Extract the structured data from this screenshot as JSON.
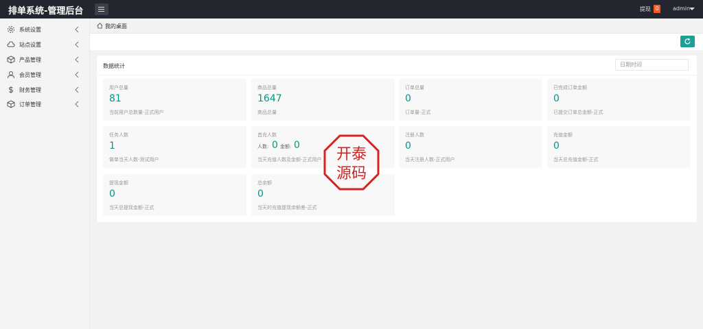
{
  "header": {
    "brand": "排单系统-管理后台",
    "withdraw_label": "提现",
    "withdraw_count": "0",
    "user": "admin"
  },
  "sidebar": {
    "items": [
      {
        "label": "系统设置",
        "icon": "gear-icon"
      },
      {
        "label": "站点设置",
        "icon": "site-icon"
      },
      {
        "label": "产品管理",
        "icon": "cube-icon"
      },
      {
        "label": "会员管理",
        "icon": "user-icon"
      },
      {
        "label": "财务管理",
        "icon": "dollar-icon"
      },
      {
        "label": "订单管理",
        "icon": "cube-icon"
      }
    ]
  },
  "breadcrumb": {
    "label": "我的桌面"
  },
  "panel": {
    "title": "数据统计",
    "date_placeholder": "日期时间"
  },
  "stats": [
    {
      "label": "用户总量",
      "value": "81",
      "desc": "当前用户总数量-正式用户"
    },
    {
      "label": "商品总量",
      "value": "1647",
      "desc": "商品总量"
    },
    {
      "label": "订单总量",
      "value": "0",
      "desc": "订单量-正式"
    },
    {
      "label": "已完成订单金额",
      "value": "0",
      "desc": "已提交订单总金额-正式"
    },
    {
      "label": "任务人数",
      "value": "1",
      "desc": "做单当天人数-测试用户"
    },
    {
      "label": "首充人数",
      "sub_people_label": "人数:",
      "sub_people_value": "0",
      "sub_amount_label": "金额:",
      "sub_amount_value": "0",
      "desc": "当天充值人数及金额-正式用户"
    },
    {
      "label": "注册人数",
      "value": "0",
      "desc": "当天注册人数-正式用户"
    },
    {
      "label": "充值金额",
      "value": "0",
      "desc": "当天总充值金额-正式"
    },
    {
      "label": "提现金额",
      "value": "0",
      "desc": "当天总提现金额-正式"
    },
    {
      "label": "总余额",
      "value": "0",
      "desc": "当天的充值提现余额差-正式"
    }
  ],
  "watermark": {
    "line1": "开泰",
    "line2": "源码",
    "color": "#d6221e"
  },
  "colors": {
    "accent": "#009688",
    "topbar": "#23262e",
    "badge": "#ff5722"
  }
}
